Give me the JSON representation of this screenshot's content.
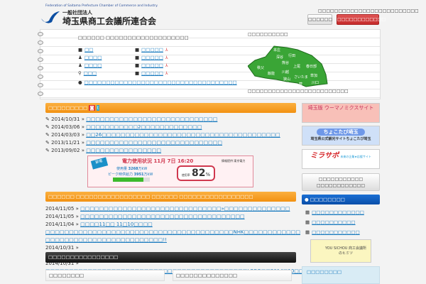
{
  "header": {
    "federation": "Federation of Saitama Prefecture Chamber of Commerce and Industry.",
    "subtitle": "一般社団法人",
    "org": "埼玉県商工会議所連合会",
    "tagline": "□□□□□□□□□□□□□□□□□□□□□□□□□",
    "button1": "□□□□□□",
    "button2": "□□□□□□□□□□□□"
  },
  "info": {
    "intro": "□□□□□□ □□□□□□□□□□□□□□□□□□□",
    "left": [
      {
        "icon": "book-icon",
        "label": "□□"
      },
      {
        "icon": "person-icon",
        "label": "□□□□"
      },
      {
        "icon": "person-icon",
        "label": "□□□□"
      },
      {
        "icon": "map-pin-icon",
        "label": "□□□"
      }
    ],
    "right": [
      {
        "label": "□□□□□"
      },
      {
        "label": "□□□□□"
      },
      {
        "label": "□□□□□"
      },
      {
        "label": "□□□□□"
      }
    ],
    "bottom_link": "□□□□□□□□□□□□□□□□□□□□□□□□□□□□□□□□□□□",
    "map_title": "□□□□□□□□□□",
    "map_note": "□□□□□□□□□□□□□□□□□□□□□□□□□",
    "map_cities": [
      "本庄",
      "深谷",
      "行田",
      "熊谷",
      "秩父",
      "上尾",
      "春日部",
      "川越",
      "飯能",
      "狭山",
      "さいたま",
      "草加",
      "所沢",
      "蕨",
      "川口"
    ],
    "map_color": "#3aa536"
  },
  "blog": {
    "title": "□□□□□□□□□",
    "items": [
      {
        "date": "2014/10/31",
        "text": "□□□□□□□□□□□□□□□□□□□□□□□□□□□□"
      },
      {
        "date": "2014/03/06",
        "text": "□□□□□□□□□□□2□□□□□□□□□□□□□"
      },
      {
        "date": "2014/03/03",
        "text": "□□26□□□□□□□□□□□□□□□□□□□□□□□□□□□□□□□□□□□□□□"
      },
      {
        "date": "2013/11/21",
        "text": "□□□□□□□□□□□□□□□□□□□□□□□□□□□□□"
      },
      {
        "date": "2013/09/02",
        "text": "□□□□□□□□□□□□□□□□"
      }
    ]
  },
  "power": {
    "title": "電力使用状況",
    "month": "11",
    "day": "7",
    "time": "16:20",
    "source": "情報提供:東京電力",
    "usage_label": "使用量",
    "usage": "3268",
    "peak_label": "ピーク時供給力",
    "peak": "3951",
    "unit": "万kW",
    "rate_label": "使用率",
    "rate": "82",
    "percent": "%",
    "rate_value": 82
  },
  "news": {
    "title": "□□□□□□ □□□□□□□□□□□□□□□□□ □□□□□□ □□□□□□□□□□□□□□□□□",
    "items": [
      {
        "date": "2014/11/05",
        "text": "□□□□□□□□□□□□□□□□□□□□□□□□□□□□□□»□□□□□□□□□□□□□□"
      },
      {
        "date": "2014/11/05",
        "text": "□□□□□□□□□□□□□□□□□□□□□□□□□□□□□□□□□□□"
      },
      {
        "date": "2014/11/04",
        "text": "□□□□11□□ 11□10□□□□ □□□□□□□□□□□□□□□□□□□□□□□□□□□□□□□□□□□□□□□□NHK□□□□□□□□□□□□ □□□□□□□□□□□□□□□□□□□□□□□□□!!"
      },
      {
        "date": "2014/10/31",
        "text": "□□□□□□□□□□□□□□□□□□□□□□□□□□□□□□□□□□□□□□2014/10/21□□□□□□□"
      },
      {
        "date": "2014/10/31",
        "text": "□□□□□□□□□□□□□□□□□□□□□□□□□□□□□□□□□□□□□□□□□□□LOBO□□2014□10□□□□"
      }
    ]
  },
  "section_dark": "□□□□□□□□□□□□□□□□",
  "panel_left": "□□□□□□□□",
  "panel_right": "□□□□□□□□□□□□□□",
  "sidebar": {
    "banners": [
      "埼玉版 ウーマノミクスサイト",
      "ちょこたび埼玉",
      "ミラサポ"
    ],
    "chokotabi_sub": "埼玉県公式観光サイトちょこたび埼玉",
    "mirasapo_sub": "未来の企業★応援サイト",
    "grey_button": [
      "□□□□□□□□□□□",
      "□□□□□□□□□□□□"
    ],
    "blue_title": "□□□□□□□□",
    "links": [
      "□□□□□□□□□□□□",
      "□□□□□□□□□□",
      "□□□□□□□□□□□"
    ],
    "mascot_banner": "YOU SICHOU 商工会議所のヒミツ",
    "box_title": "□□□□□□□□"
  }
}
